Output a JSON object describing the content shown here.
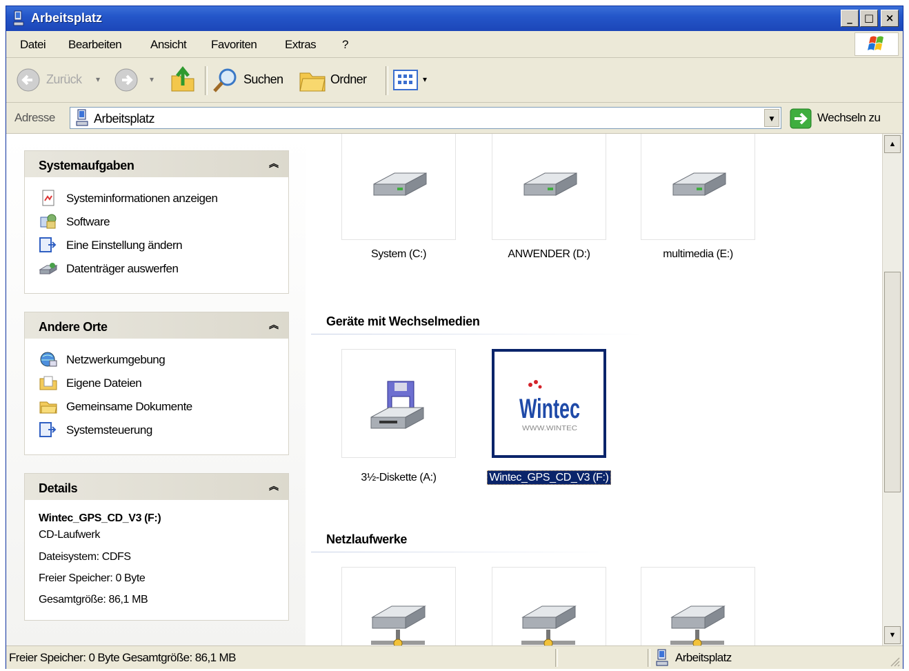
{
  "window": {
    "title": "Arbeitsplatz"
  },
  "titlebar_buttons": {
    "minimize": "_",
    "maximize": "□",
    "close": "×"
  },
  "menu": [
    "Datei",
    "Bearbeiten",
    "Ansicht",
    "Favoriten",
    "Extras",
    "?"
  ],
  "toolbar": {
    "back": "Zurück",
    "search": "Suchen",
    "folders": "Ordner"
  },
  "address": {
    "label": "Adresse",
    "value": "Arbeitsplatz",
    "go": "Wechseln zu"
  },
  "panels": {
    "system_tasks": {
      "title": "Systemaufgaben",
      "items": [
        "Systeminformationen anzeigen",
        "Software",
        "Eine Einstellung ändern",
        "Datenträger auswerfen"
      ]
    },
    "other_places": {
      "title": "Andere Orte",
      "items": [
        "Netzwerkumgebung",
        "Eigene Dateien",
        "Gemeinsame Dokumente",
        "Systemsteuerung"
      ]
    },
    "details": {
      "title": "Details",
      "name": "Wintec_GPS_CD_V3 (F:)",
      "type": "CD-Laufwerk",
      "filesystem": "Dateisystem: CDFS",
      "free": "Freier Speicher: 0 Byte",
      "total": "Gesamtgröße: 86,1 MB"
    }
  },
  "drives": {
    "hard_disks": [
      "System (C:)",
      "ANWENDER (D:)",
      "multimedia (E:)"
    ],
    "removable_title": "Geräte mit Wechselmedien",
    "removable": [
      "3½-Diskette (A:)",
      "Wintec_GPS_CD_V3 (F:)"
    ],
    "network_title": "Netzlaufwerke"
  },
  "cd_logo": {
    "brand": "Wintec",
    "sub": "WWW.WINTEC"
  },
  "status": {
    "left": "Freier Speicher: 0 Byte Gesamtgröße: 86,1 MB",
    "right": "Arbeitsplatz"
  },
  "colors": {
    "titlebar": "#2456c9",
    "selection": "#0a246a",
    "background": "#ece9d8"
  }
}
